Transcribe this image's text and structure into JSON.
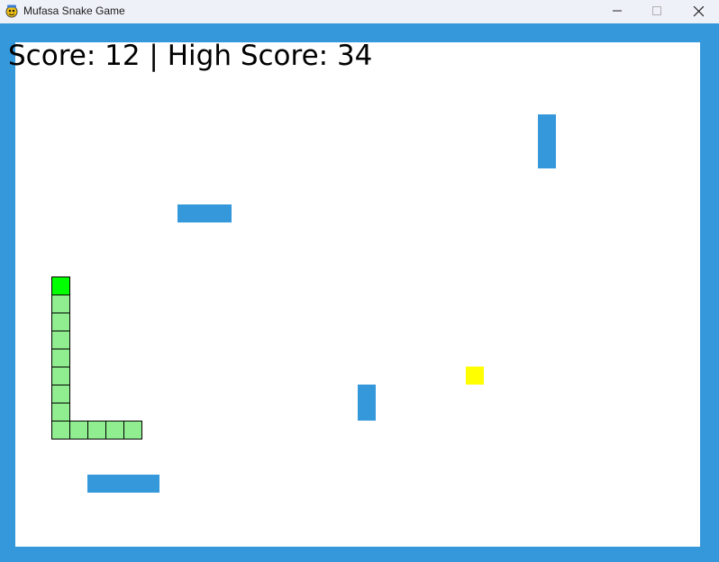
{
  "window": {
    "title": "Mufasa Snake Game",
    "icon": "pygame-snake-icon",
    "controls": [
      "minimize-icon",
      "maximize-icon",
      "close-icon"
    ]
  },
  "hud": {
    "score_label": "Score",
    "score": 12,
    "high_score_label": "High Score",
    "high_score": 34,
    "text": "Score: 12 | High Score: 34"
  },
  "colors": {
    "border": "#3498db",
    "background": "#ffffff",
    "snake_head": "#00ff00",
    "snake_body": "#90ee90",
    "snake_outline": "#000000",
    "food": "#ffff00",
    "obstacle": "#3498db",
    "text": "#000000"
  },
  "grid": {
    "cell_size": 20
  },
  "snake": {
    "direction": "up",
    "length": 13,
    "segments": [
      [
        3,
        14
      ],
      [
        3,
        15
      ],
      [
        3,
        16
      ],
      [
        3,
        17
      ],
      [
        3,
        18
      ],
      [
        3,
        19
      ],
      [
        3,
        20
      ],
      [
        3,
        21
      ],
      [
        3,
        22
      ],
      [
        4,
        22
      ],
      [
        5,
        22
      ],
      [
        6,
        22
      ],
      [
        7,
        22
      ]
    ]
  },
  "food": {
    "cell": [
      26,
      19
    ]
  },
  "obstacles": [
    {
      "cell": [
        30,
        5
      ],
      "w": 1,
      "h": 3
    },
    {
      "cell": [
        10,
        10
      ],
      "w": 3,
      "h": 1
    },
    {
      "cell": [
        20,
        20
      ],
      "w": 1,
      "h": 2
    },
    {
      "cell": [
        5,
        25
      ],
      "w": 4,
      "h": 1
    }
  ]
}
